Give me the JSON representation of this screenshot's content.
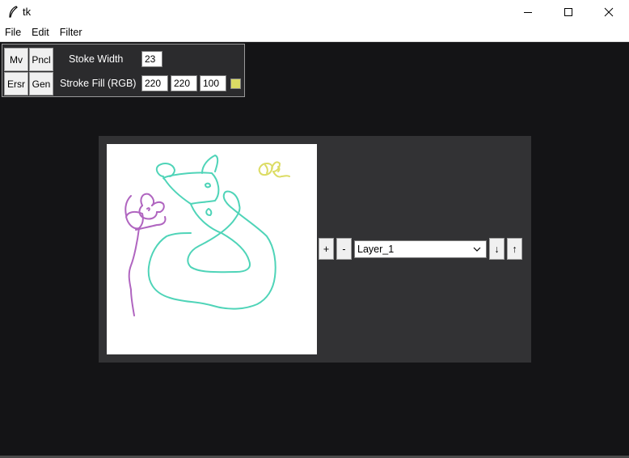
{
  "window": {
    "title": "tk"
  },
  "menu": [
    "File",
    "Edit",
    "Filter"
  ],
  "toolbar": {
    "move_label": "Mv",
    "pencil_label": "Pncl",
    "eraser_label": "Ersr",
    "generate_label": "Gen",
    "stroke_width_label": "Stoke Width",
    "stroke_width_value": "23",
    "stroke_fill_label": "Stroke Fill (RGB)",
    "fill_r": "220",
    "fill_g": "220",
    "fill_b": "100",
    "fill_color": "#dcdc64"
  },
  "layers": {
    "add_label": "+",
    "remove_label": "-",
    "selected": "Layer_1",
    "move_down_label": "↓",
    "move_up_label": "↑"
  },
  "colors": {
    "background": "#141416",
    "panel": "#323234",
    "teal_stroke": "#4fd4b8",
    "purple_stroke": "#b065c0",
    "yellow_stroke": "#dcdc64"
  }
}
